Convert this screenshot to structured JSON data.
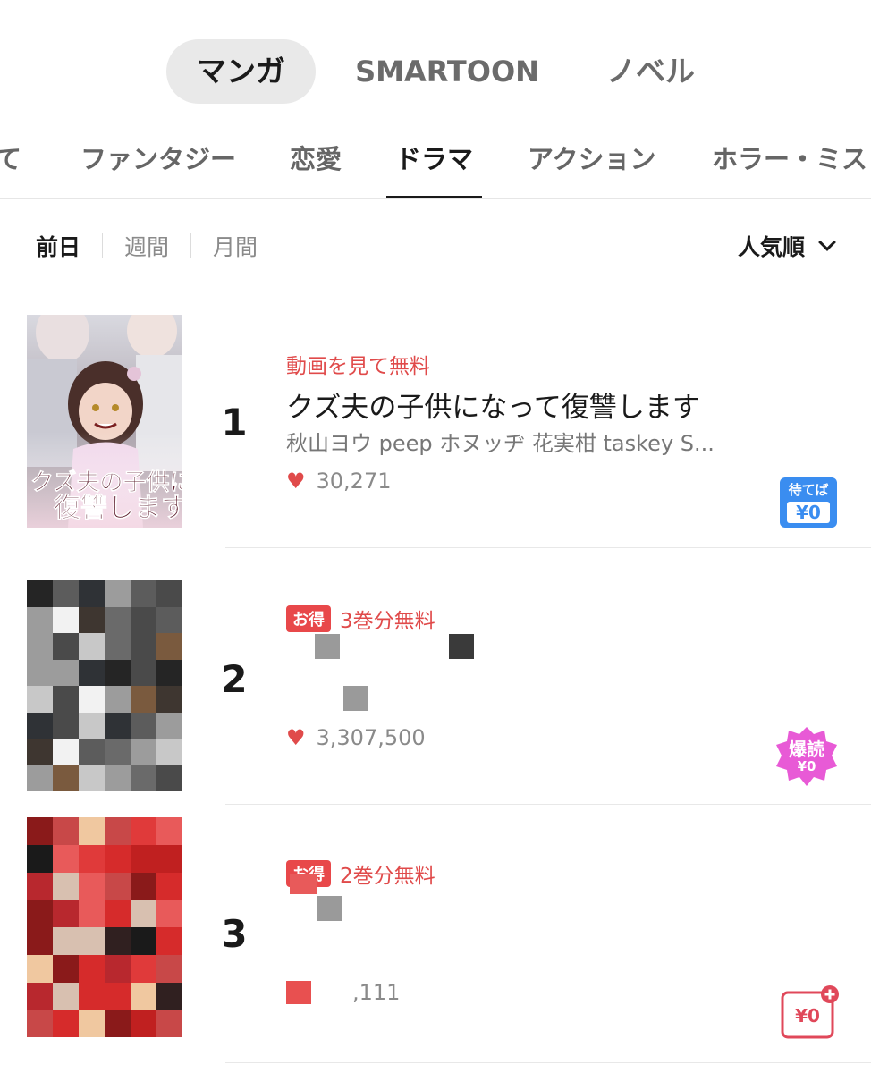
{
  "top_tabs": [
    {
      "label": "マンガ",
      "active": true
    },
    {
      "label": "SMARTOON",
      "active": false
    },
    {
      "label": "ノベル",
      "active": false
    }
  ],
  "genres": [
    {
      "label": "て"
    },
    {
      "label": "ファンタジー"
    },
    {
      "label": "恋愛"
    },
    {
      "label": "ドラマ",
      "active": true
    },
    {
      "label": "アクション"
    },
    {
      "label": "ホラー・ミス"
    }
  ],
  "period": {
    "items": [
      "前日",
      "週間",
      "月間"
    ],
    "active": "前日"
  },
  "sort": {
    "label": "人気順"
  },
  "ranking": [
    {
      "rank": "1",
      "promo": "動画を見て無料",
      "title": "クズ夫の子供になって復讐します",
      "authors": "秋山ヨウ peep ホヌッヂ 花実柑 taskey S...",
      "likes": "30,271",
      "badge": {
        "line1": "待てば",
        "line2": "¥0",
        "color": "#3a8df0"
      },
      "cover_text": "クズ夫の子供になって復讐します"
    },
    {
      "rank": "2",
      "promo_tag": "お得",
      "promo": "3巻分無料",
      "likes": "3,307,500",
      "badge": {
        "line1": "爆読",
        "line2": "¥0",
        "color": "#e040d0"
      }
    },
    {
      "rank": "3",
      "promo_tag": "お得",
      "promo": "2巻分無料",
      "likes": ",111",
      "badge": {
        "line1": "¥0",
        "color": "#e04a5a"
      }
    }
  ],
  "icons": [
    "heart-icon",
    "chevron-down-icon"
  ],
  "colors": {
    "accent_red": "#e04a4a",
    "wait_blue": "#3a8df0",
    "baku_pink": "#e040d0"
  }
}
